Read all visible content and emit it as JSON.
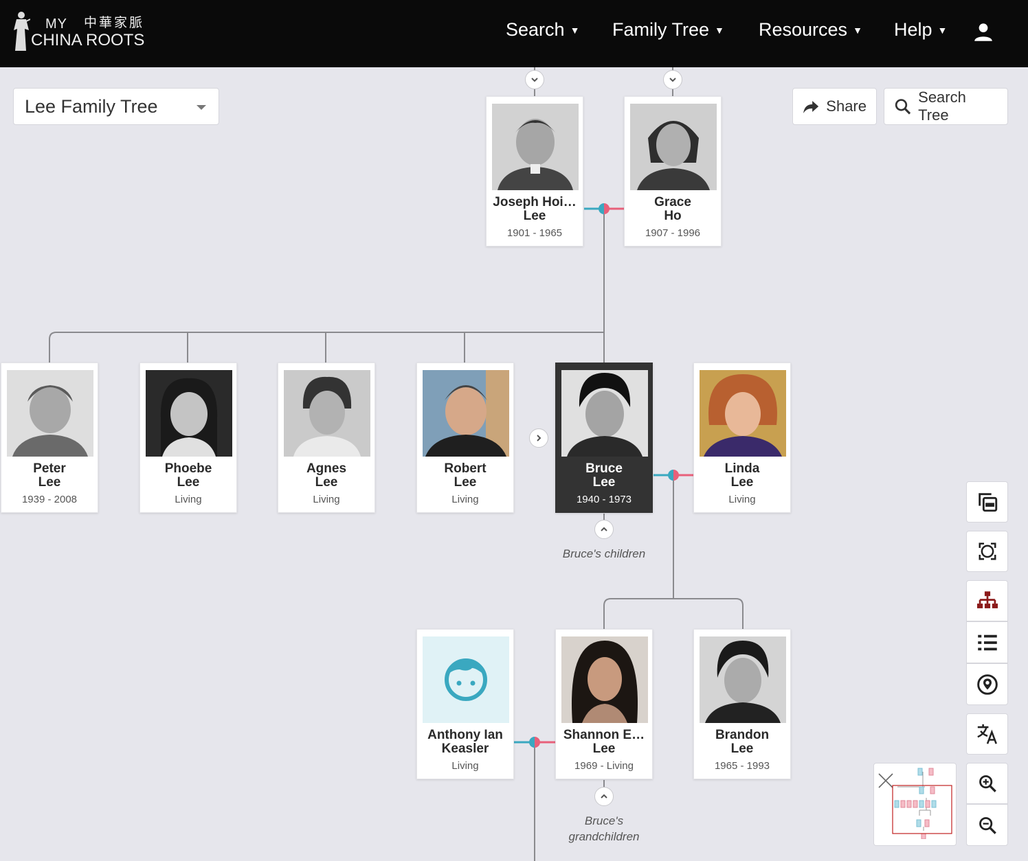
{
  "brand": {
    "logo_my": "MY",
    "logo_chinese": "中華家脈",
    "logo_roots": "CHINA ROOTS"
  },
  "nav": {
    "search": "Search",
    "family_tree": "Family Tree",
    "resources": "Resources",
    "help": "Help"
  },
  "tree_select": {
    "value": "Lee Family Tree"
  },
  "actions": {
    "share": "Share",
    "search_tree": "Search Tree"
  },
  "people": {
    "joseph": {
      "first": "Joseph Hoi…",
      "last": "Lee",
      "dates": "1901 - 1965"
    },
    "grace": {
      "first": "Grace",
      "last": "Ho",
      "dates": "1907 - 1996"
    },
    "peter": {
      "first": "Peter",
      "last": "Lee",
      "dates": "1939 - 2008"
    },
    "phoebe": {
      "first": "Phoebe",
      "last": "Lee",
      "dates": "Living"
    },
    "agnes": {
      "first": "Agnes",
      "last": "Lee",
      "dates": "Living"
    },
    "robert": {
      "first": "Robert",
      "last": "Lee",
      "dates": "Living"
    },
    "bruce": {
      "first": "Bruce",
      "last": "Lee",
      "dates": "1940 - 1973"
    },
    "linda": {
      "first": "Linda",
      "last": "Lee",
      "dates": "Living"
    },
    "anthony": {
      "first": "Anthony Ian",
      "last": "Keasler",
      "dates": "Living"
    },
    "shannon": {
      "first": "Shannon E…",
      "last": "Lee",
      "dates": "1969 - Living"
    },
    "brandon": {
      "first": "Brandon",
      "last": "Lee",
      "dates": "1965 - 1993"
    }
  },
  "captions": {
    "children": "Bruce's children",
    "grandchildren_1": "Bruce's",
    "grandchildren_2": "grandchildren"
  },
  "colors": {
    "male_line": "#3aa8c0",
    "female_line": "#e8607a",
    "selected_card": "#333333",
    "tree_tool": "#8b1a1a",
    "placeholder_avatar": "#3aa8c0"
  }
}
